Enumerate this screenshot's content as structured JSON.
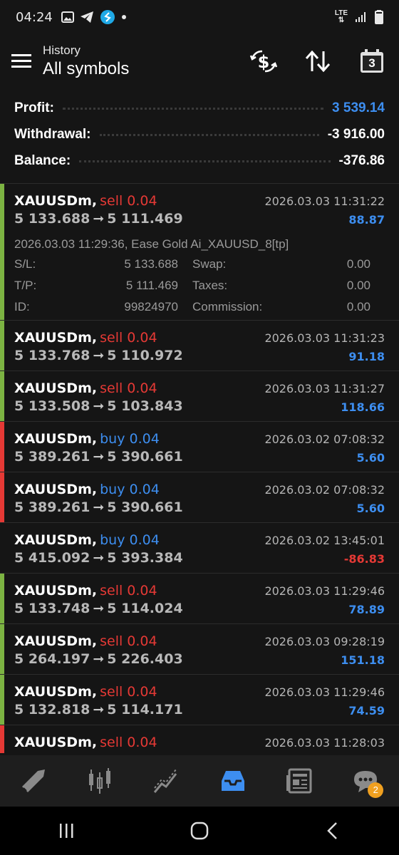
{
  "status_bar": {
    "time": "04:24",
    "network": "LTE"
  },
  "header": {
    "subtitle": "History",
    "title": "All symbols",
    "calendar_day": "3"
  },
  "summary": [
    {
      "label": "Profit:",
      "value": "3 539.14",
      "color": "#3d8ef0"
    },
    {
      "label": "Withdrawal:",
      "value": "-3 916.00",
      "color": "#ffffff"
    },
    {
      "label": "Balance:",
      "value": "-376.86",
      "color": "#ffffff"
    }
  ],
  "colors": {
    "sell": "#e53935",
    "buy": "#3d8ef0",
    "profit_pos": "#3d8ef0",
    "profit_neg": "#e53935",
    "bar_green": "#7cb342",
    "bar_red": "#e53935",
    "accent": "#3d8ef0"
  },
  "trades": [
    {
      "symbol": "XAUUSDm,",
      "side": "sell 0.04",
      "side_type": "sell",
      "time": "2026.03.03 11:31:22",
      "open": "5 133.688",
      "close": "5 111.469",
      "profit": "88.87",
      "profit_type": "pos",
      "bar": "green",
      "expanded": true,
      "details": {
        "comment": "2026.03.03 11:29:36, Ease Gold Ai_XAUUSD_8[tp]",
        "sl_label": "S/L:",
        "sl": "5 133.688",
        "swap_label": "Swap:",
        "swap": "0.00",
        "tp_label": "T/P:",
        "tp": "5 111.469",
        "taxes_label": "Taxes:",
        "taxes": "0.00",
        "id_label": "ID:",
        "id": "99824970",
        "commission_label": "Commission:",
        "commission": "0.00"
      }
    },
    {
      "symbol": "XAUUSDm,",
      "side": "sell 0.04",
      "side_type": "sell",
      "time": "2026.03.03 11:31:23",
      "open": "5 133.768",
      "close": "5 110.972",
      "profit": "91.18",
      "profit_type": "pos",
      "bar": "green"
    },
    {
      "symbol": "XAUUSDm,",
      "side": "sell 0.04",
      "side_type": "sell",
      "time": "2026.03.03 11:31:27",
      "open": "5 133.508",
      "close": "5 103.843",
      "profit": "118.66",
      "profit_type": "pos",
      "bar": "green"
    },
    {
      "symbol": "XAUUSDm,",
      "side": "buy 0.04",
      "side_type": "buy",
      "time": "2026.03.02 07:08:32",
      "open": "5 389.261",
      "close": "5 390.661",
      "profit": "5.60",
      "profit_type": "pos",
      "bar": "red"
    },
    {
      "symbol": "XAUUSDm,",
      "side": "buy 0.04",
      "side_type": "buy",
      "time": "2026.03.02 07:08:32",
      "open": "5 389.261",
      "close": "5 390.661",
      "profit": "5.60",
      "profit_type": "pos",
      "bar": "red"
    },
    {
      "symbol": "XAUUSDm,",
      "side": "buy 0.04",
      "side_type": "buy",
      "time": "2026.03.02 13:45:01",
      "open": "5 415.092",
      "close": "5 393.384",
      "profit": "-86.83",
      "profit_type": "neg",
      "bar": "none"
    },
    {
      "symbol": "XAUUSDm,",
      "side": "sell 0.04",
      "side_type": "sell",
      "time": "2026.03.03 11:29:46",
      "open": "5 133.748",
      "close": "5 114.024",
      "profit": "78.89",
      "profit_type": "pos",
      "bar": "green"
    },
    {
      "symbol": "XAUUSDm,",
      "side": "sell 0.04",
      "side_type": "sell",
      "time": "2026.03.03 09:28:19",
      "open": "5 264.197",
      "close": "5 226.403",
      "profit": "151.18",
      "profit_type": "pos",
      "bar": "green"
    },
    {
      "symbol": "XAUUSDm,",
      "side": "sell 0.04",
      "side_type": "sell",
      "time": "2026.03.03 11:29:46",
      "open": "5 132.818",
      "close": "5 114.171",
      "profit": "74.59",
      "profit_type": "pos",
      "bar": "green"
    },
    {
      "symbol": "XAUUSDm,",
      "side": "sell 0.04",
      "side_type": "sell",
      "time": "2026.03.03 11:28:03",
      "open": "",
      "close": "",
      "profit": "",
      "profit_type": "pos",
      "bar": "red"
    }
  ],
  "bottom_nav": [
    {
      "icon": "trade-arrow-icon",
      "active": false
    },
    {
      "icon": "candlestick-chart-icon",
      "active": false
    },
    {
      "icon": "trend-line-icon",
      "active": false
    },
    {
      "icon": "history-inbox-icon",
      "active": true
    },
    {
      "icon": "news-icon",
      "active": false
    },
    {
      "icon": "chat-icon",
      "active": false,
      "badge": "2"
    }
  ],
  "system_nav": [
    "recent-apps-icon",
    "home-icon",
    "back-icon"
  ]
}
